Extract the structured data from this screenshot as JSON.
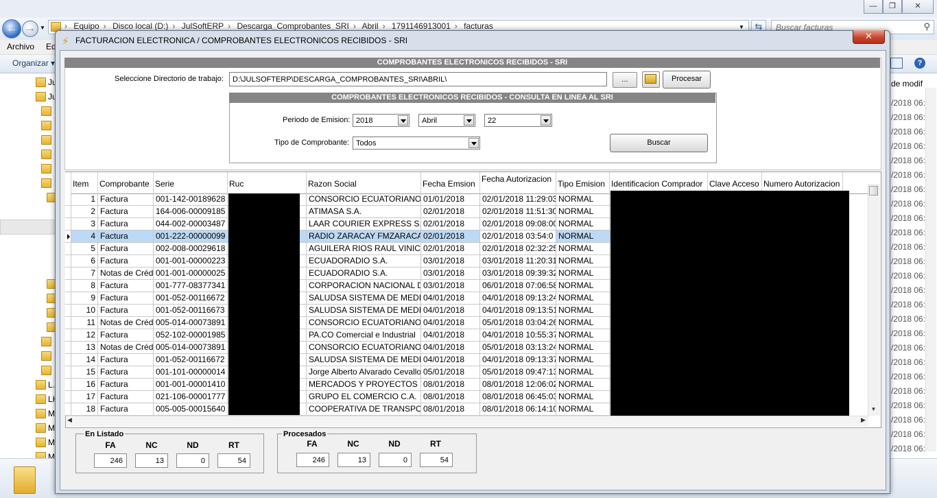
{
  "explorer": {
    "breadcrumbs": [
      "Equipo",
      "Disco local (D:)",
      "JulSoftERP",
      "Descarga_Comprobantes_SRI",
      "Abril",
      "1791146913001",
      "facturas"
    ],
    "search_placeholder": "Buscar facturas",
    "menu": [
      "Archivo",
      "Ed"
    ],
    "organizar_label": "Organizar ▾",
    "nav_labels": [
      "Ju",
      "Ju",
      "L.",
      "LH",
      "M",
      "M",
      "M",
      "M"
    ],
    "right_header": "de modif",
    "date_prefix": "/2018 06:4"
  },
  "dialog": {
    "title": "FACTURACION ELECTRONICA / COMPROBANTES ELECTRONICOS RECIBIDOS - SRI",
    "close_label": "✕",
    "header_main": "COMPROBANTES ELECTRONICOS RECIBIDOS - SRI",
    "dir_label": "Seleccione Directorio de trabajo:",
    "dir_value": "D:\\JULSOFTERP\\DESCARGA_COMPROBANTES_SRI\\ABRIL\\",
    "browse_label": "...",
    "procesar_label": "Procesar",
    "header_sub": "COMPROBANTES ELECTRONICOS RECIBIDOS - CONSULTA EN LINEA AL SRI",
    "periodo_label": "Periodo de Emision:",
    "year": "2018",
    "month": "Abril",
    "day": "22",
    "tipo_label": "Tipo de Comprobante:",
    "tipo": "Todos",
    "buscar_label": "Buscar"
  },
  "grid": {
    "columns": [
      "Item",
      "Comprobante",
      "Serie",
      "Ruc",
      "Razon Social",
      "Fecha Emsion",
      "Fecha Autorizacion",
      "Tipo Emision",
      "Identificacion Comprador",
      "Clave Acceso",
      "Numero Autorizacion"
    ],
    "selected_index": 3,
    "rows": [
      {
        "item": "1",
        "comprobante": "Factura",
        "serie": "001-142-00189628",
        "razon": "CONSORCIO ECUATORIANO",
        "fecha_emision": "01/01/2018",
        "fecha_aut": "02/01/2018 11:29:03",
        "tipo": "NORMAL"
      },
      {
        "item": "2",
        "comprobante": "Factura",
        "serie": "164-006-00009185",
        "razon": "ATIMASA S.A.",
        "fecha_emision": "02/01/2018",
        "fecha_aut": "02/01/2018 11:51:30",
        "tipo": "NORMAL"
      },
      {
        "item": "3",
        "comprobante": "Factura",
        "serie": "044-002-00003487",
        "razon": "LAAR COURIER EXPRESS S.A.",
        "fecha_emision": "02/01/2018",
        "fecha_aut": "02/01/2018 09:08:00",
        "tipo": "NORMAL"
      },
      {
        "item": "4",
        "comprobante": "Factura",
        "serie": "001-222-00000099",
        "razon": "RADIO ZARACAY FMZARACAY",
        "fecha_emision": "02/01/2018",
        "fecha_aut": "02/01/2018 03:54:0",
        "tipo": "NORMAL"
      },
      {
        "item": "5",
        "comprobante": "Factura",
        "serie": "002-008-00029618",
        "razon": "AGUILERA RIOS RAUL VINICIO",
        "fecha_emision": "02/01/2018",
        "fecha_aut": "02/01/2018 02:32:25",
        "tipo": "NORMAL"
      },
      {
        "item": "6",
        "comprobante": "Factura",
        "serie": "001-001-00000223",
        "razon": "ECUADORADIO S.A.",
        "fecha_emision": "03/01/2018",
        "fecha_aut": "03/01/2018 11:20:31",
        "tipo": "NORMAL"
      },
      {
        "item": "7",
        "comprobante": "Notas de Crédito",
        "serie": "001-001-00000025",
        "razon": "ECUADORADIO S.A.",
        "fecha_emision": "03/01/2018",
        "fecha_aut": "03/01/2018 09:39:32",
        "tipo": "NORMAL"
      },
      {
        "item": "8",
        "comprobante": "Factura",
        "serie": "001-777-08377341",
        "razon": "CORPORACION NACIONAL DE",
        "fecha_emision": "03/01/2018",
        "fecha_aut": "06/01/2018 07:06:58",
        "tipo": "NORMAL"
      },
      {
        "item": "9",
        "comprobante": "Factura",
        "serie": "001-052-00116672",
        "razon": "SALUDSA SISTEMA DE MEDICINA",
        "fecha_emision": "04/01/2018",
        "fecha_aut": "04/01/2018 09:13:24",
        "tipo": "NORMAL"
      },
      {
        "item": "10",
        "comprobante": "Factura",
        "serie": "001-052-00116673",
        "razon": "SALUDSA SISTEMA DE MEDICINA",
        "fecha_emision": "04/01/2018",
        "fecha_aut": "04/01/2018 09:13:51",
        "tipo": "NORMAL"
      },
      {
        "item": "11",
        "comprobante": "Notas de Crédito",
        "serie": "005-014-00073891",
        "razon": "CONSORCIO ECUATORIANO",
        "fecha_emision": "04/01/2018",
        "fecha_aut": "05/01/2018 03:04:26",
        "tipo": "NORMAL"
      },
      {
        "item": "12",
        "comprobante": "Factura",
        "serie": "052-102-00001985",
        "razon": "PA.CO Comercial e Industrial",
        "fecha_emision": "04/01/2018",
        "fecha_aut": "04/01/2018 10:55:37",
        "tipo": "NORMAL"
      },
      {
        "item": "13",
        "comprobante": "Notas de Crédito",
        "serie": "005-014-00073891",
        "razon": "CONSORCIO ECUATORIANO",
        "fecha_emision": "04/01/2018",
        "fecha_aut": "05/01/2018 03:13:24",
        "tipo": "NORMAL"
      },
      {
        "item": "14",
        "comprobante": "Factura",
        "serie": "001-052-00116672",
        "razon": "SALUDSA SISTEMA DE MEDICINA",
        "fecha_emision": "04/01/2018",
        "fecha_aut": "04/01/2018 09:13:37",
        "tipo": "NORMAL"
      },
      {
        "item": "15",
        "comprobante": "Factura",
        "serie": "001-101-00000014",
        "razon": "Jorge Alberto Alvarado Cevallos",
        "fecha_emision": "05/01/2018",
        "fecha_aut": "05/01/2018 09:47:13",
        "tipo": "NORMAL"
      },
      {
        "item": "16",
        "comprobante": "Factura",
        "serie": "001-001-00001410",
        "razon": "MERCADOS Y PROYECTOS M",
        "fecha_emision": "08/01/2018",
        "fecha_aut": "08/01/2018 12:06:02",
        "tipo": "NORMAL"
      },
      {
        "item": "17",
        "comprobante": "Factura",
        "serie": "021-106-00001777",
        "razon": "GRUPO EL COMERCIO C.A.",
        "fecha_emision": "08/01/2018",
        "fecha_aut": "08/01/2018 06:45:03",
        "tipo": "NORMAL"
      },
      {
        "item": "18",
        "comprobante": "Factura",
        "serie": "005-005-00015640",
        "razon": "COOPERATIVA DE TRANSPORTE",
        "fecha_emision": "08/01/2018",
        "fecha_aut": "08/01/2018 06:14:10",
        "tipo": "NORMAL"
      }
    ]
  },
  "summary": {
    "listado": {
      "title": "En Listado",
      "headers": [
        "FA",
        "NC",
        "ND",
        "RT"
      ],
      "values": [
        "246",
        "13",
        "0",
        "54"
      ]
    },
    "procesados": {
      "title": "Procesados",
      "headers": [
        "FA",
        "NC",
        "ND",
        "RT"
      ],
      "values": [
        "246",
        "13",
        "0",
        "54"
      ]
    }
  }
}
